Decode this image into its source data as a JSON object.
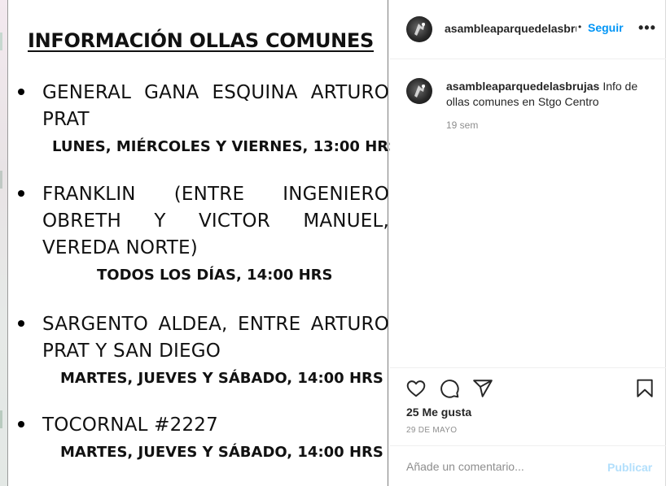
{
  "post_image": {
    "title": "INFORMACIÓN OLLAS COMUNES",
    "locations": [
      {
        "address": "GENERAL GANA ESQUINA ARTURO PRAT",
        "schedule": "LUNES, MIÉRCOLES Y VIERNES, 13:00 HRS"
      },
      {
        "address": "FRANKLIN (ENTRE INGENIERO OBRETH Y VICTOR MANUEL, VEREDA NORTE)",
        "schedule": "TODOS LOS DÍAS, 14:00 HRS"
      },
      {
        "address": "SARGENTO ALDEA, ENTRE ARTURO PRAT Y SAN DIEGO",
        "schedule": "MARTES, JUEVES Y SÁBADO, 14:00 HRS"
      },
      {
        "address": "TOCORNAL #2227",
        "schedule": "MARTES, JUEVES Y SÁBADO, 14:00 HRS"
      }
    ]
  },
  "header": {
    "username": "asambleaparquedelasbrujas",
    "separator": "•",
    "follow_label": "Seguir",
    "more_label": "•••",
    "more_icon": "more-horizontal-icon"
  },
  "caption": {
    "username": "asambleaparquedelasbrujas",
    "text": "Info de ollas comunes en Stgo Centro",
    "time": "19 sem"
  },
  "actions": {
    "icons": [
      "heart-icon",
      "comment-icon",
      "share-icon",
      "bookmark-icon"
    ],
    "likes": "25 Me gusta",
    "date": "29 DE MAYO"
  },
  "comment": {
    "placeholder": "Añade un comentario...",
    "publish_label": "Publicar"
  },
  "colors": {
    "link_blue": "#0095f6",
    "publish_disabled": "#b2dffc",
    "muted_text": "#8e8e8e",
    "primary_text": "#262626"
  }
}
